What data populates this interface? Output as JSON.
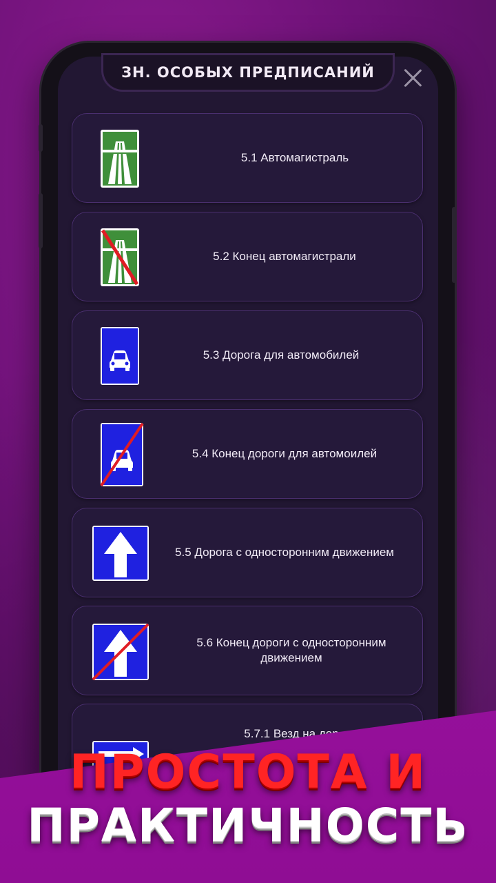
{
  "header": {
    "title": "ЗН. ОСОБЫХ ПРЕДПИСАНИЙ"
  },
  "colors": {
    "background": "#6e1278",
    "card_bg": "#25193a",
    "card_border": "#4a2f6f",
    "sign_green": "#3f8f3a",
    "sign_blue": "#1f21e0",
    "cross_red": "#e01c24",
    "promo_band": "#a80fae",
    "headline_red": "#ff2424"
  },
  "items": [
    {
      "label": "5.1 Автомагистраль",
      "icon": "motorway-sign-icon"
    },
    {
      "label": "5.2 Конец автомагистрали",
      "icon": "end-of-motorway-sign-icon"
    },
    {
      "label": "5.3 Дорога для автомобилей",
      "icon": "road-for-cars-sign-icon"
    },
    {
      "label": "5.4 Конец дороги для автомоилей",
      "icon": "end-of-road-for-cars-sign-icon"
    },
    {
      "label": "5.5 Дорога с односторонним движением",
      "icon": "one-way-road-sign-icon"
    },
    {
      "label": "5.6 Конец дороги с односторонним движением",
      "icon": "end-of-one-way-road-sign-icon"
    },
    {
      "label": "5.7.1 Везд на дор",
      "icon": "entry-one-way-road-sign-icon"
    }
  ],
  "promo": {
    "line1": "ПРОСТОТА И",
    "line2": "ПРАКТИЧНОСТЬ"
  }
}
